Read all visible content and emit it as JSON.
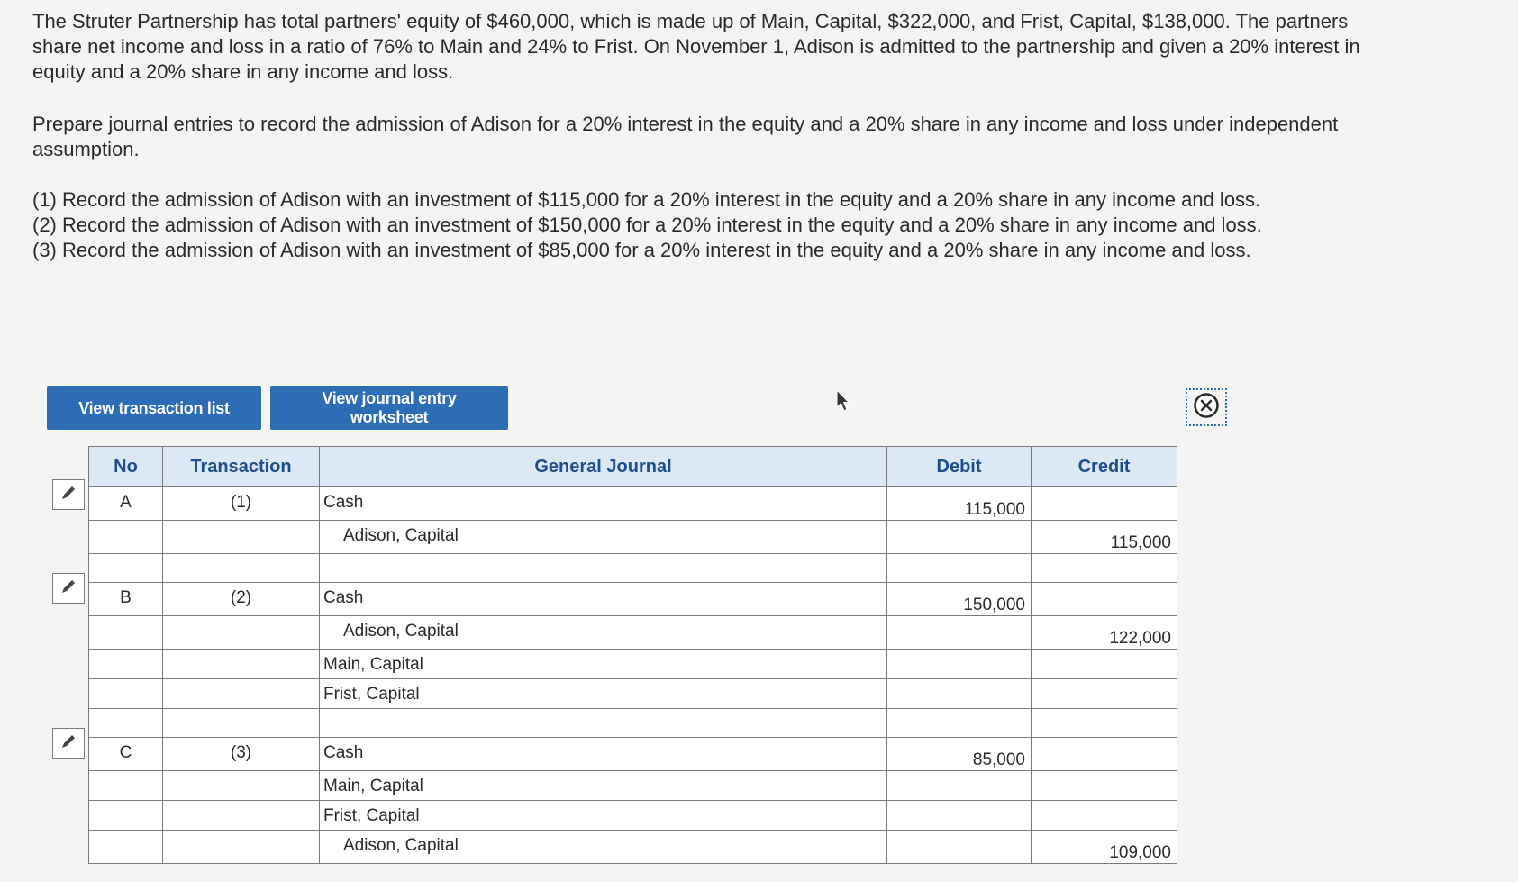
{
  "question": {
    "intro": "The Struter Partnership has total partners' equity of $460,000, which is made up of Main, Capital, $322,000, and Frist, Capital, $138,000. The partners share net income and loss in a ratio of 76% to Main and 24% to Frist. On November 1, Adison is admitted to the partnership and given a 20% interest in equity and a 20% share in any income and loss.",
    "prompt": "Prepare journal entries to record the admission of Adison for a 20% interest in the equity and a 20% share in any income and loss under independent assumption.",
    "items": [
      "(1) Record the admission of Adison with an investment of $115,000 for a 20% interest in the equity and a 20% share in any income and loss.",
      "(2) Record the admission of Adison with an investment of $150,000 for a 20% interest in the equity and a 20% share in any income and loss.",
      "(3) Record the admission of Adison with an investment of $85,000 for a 20% interest in the equity and a 20% share in any income and loss."
    ]
  },
  "buttons": {
    "view_list": "View transaction list",
    "view_worksheet": "View journal entry worksheet"
  },
  "icons": {
    "close": "close-circle-icon",
    "edit": "pencil-icon",
    "cursor": "mouse-pointer-icon"
  },
  "colors": {
    "button": "#2c6db5",
    "header_bg": "#dce8f6",
    "header_text": "#1e4e8c"
  },
  "journal": {
    "headers": {
      "no": "No",
      "transaction": "Transaction",
      "general_journal": "General Journal",
      "debit": "Debit",
      "credit": "Credit"
    },
    "rows": [
      {
        "no": "A",
        "transaction": "(1)",
        "account": "Cash",
        "debit": "115,000",
        "credit": ""
      },
      {
        "no": "",
        "transaction": "",
        "account": "Adison, Capital",
        "debit": "",
        "credit": "115,000"
      },
      {
        "no": "",
        "transaction": "",
        "account": "",
        "debit": "",
        "credit": ""
      },
      {
        "no": "B",
        "transaction": "(2)",
        "account": "Cash",
        "debit": "150,000",
        "credit": ""
      },
      {
        "no": "",
        "transaction": "",
        "account": "Adison, Capital",
        "debit": "",
        "credit": "122,000"
      },
      {
        "no": "",
        "transaction": "",
        "account": "Main, Capital",
        "debit": "",
        "credit": ""
      },
      {
        "no": "",
        "transaction": "",
        "account": "Frist, Capital",
        "debit": "",
        "credit": ""
      },
      {
        "no": "",
        "transaction": "",
        "account": "",
        "debit": "",
        "credit": ""
      },
      {
        "no": "C",
        "transaction": "(3)",
        "account": "Cash",
        "debit": "85,000",
        "credit": ""
      },
      {
        "no": "",
        "transaction": "",
        "account": "Main, Capital",
        "debit": "",
        "credit": ""
      },
      {
        "no": "",
        "transaction": "",
        "account": "Frist, Capital",
        "debit": "",
        "credit": ""
      },
      {
        "no": "",
        "transaction": "",
        "account": "Adison, Capital",
        "debit": "",
        "credit": "109,000"
      }
    ]
  }
}
